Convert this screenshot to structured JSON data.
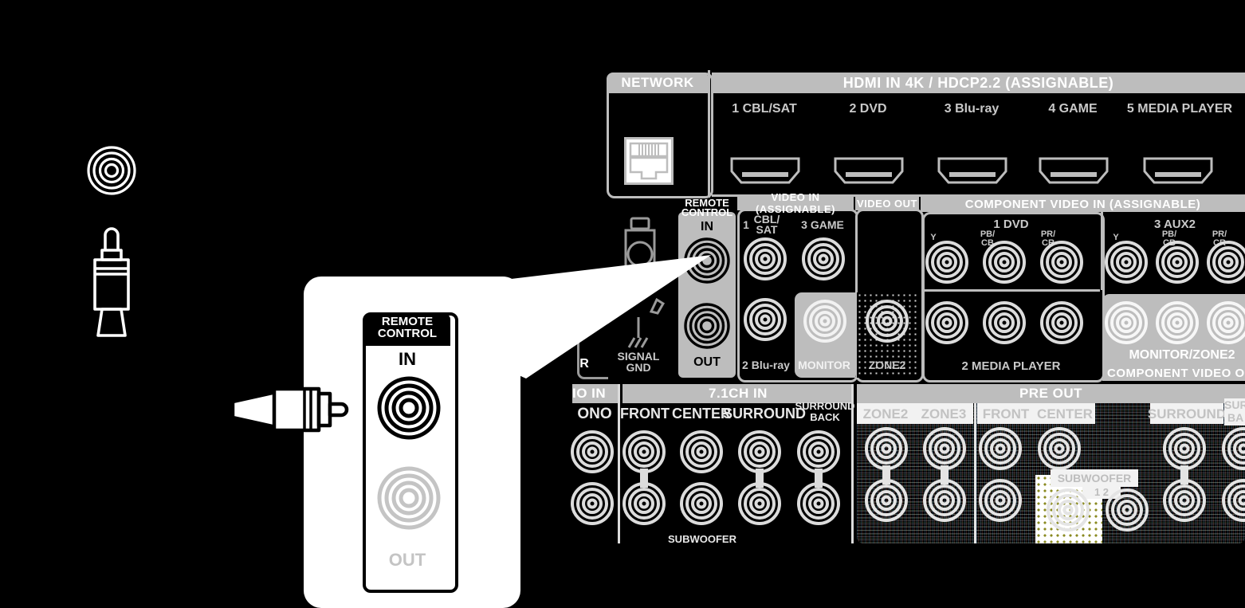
{
  "legend": {
    "jack_icon": "rca-jack-icon",
    "plug_icon": "rca-plug-icon"
  },
  "callout": {
    "cap_line1": "REMOTE",
    "cap_line2": "CONTROL",
    "in_label": "IN",
    "out_label": "OUT",
    "plug_icon": "rca-plug-horizontal-icon",
    "in_jack": "remote-control-in-jack",
    "out_jack": "remote-control-out-jack"
  },
  "rear_panel": {
    "network": {
      "header": "NETWORK",
      "port_icon": "rj45-ethernet-port-icon"
    },
    "hdmi": {
      "header": "HDMI IN   4K / HDCP2.2   (ASSIGNABLE)",
      "ports": [
        {
          "label": "1 CBL/SAT"
        },
        {
          "label": "2 DVD"
        },
        {
          "label": "3 Blu-ray"
        },
        {
          "label": "4 GAME"
        },
        {
          "label": "5 MEDIA PLAYER"
        }
      ]
    },
    "remote_control": {
      "cap_line1": "REMOTE",
      "cap_line2": "CONTROL",
      "in_label": "IN",
      "out_label": "OUT"
    },
    "antenna": {
      "icon": "am-loop-antenna-icon",
      "gnd_icon": "signal-ground-icon",
      "gnd_line1": "SIGNAL",
      "gnd_line2": "GND"
    },
    "video_in": {
      "header": "VIDEO IN (ASSIGNABLE)",
      "labels": [
        "1 CBL/\nSAT",
        "3 GAME",
        "2 Blu-ray"
      ],
      "l1a": "1",
      "l1b": "CBL/",
      "l1c": "SAT",
      "l3": "3  GAME",
      "l2": "2  Blu-ray"
    },
    "video_out": {
      "header": "VIDEO OUT",
      "monitor": "MONITOR",
      "zone2": "ZONE2"
    },
    "component_video_in": {
      "header": "COMPONENT VIDEO IN (ASSIGNABLE)",
      "group1": "1   DVD",
      "group2": "2   MEDIA PLAYER",
      "group3": "3   AUX2",
      "pins": [
        "Y",
        "PB/\nCB",
        "PR/\nCR"
      ],
      "y": "Y",
      "pb1": "PB/",
      "pb2": "CB",
      "pr1": "PR/",
      "pr2": "CR"
    },
    "component_video_out": {
      "header": "COMPONENT VIDEO O",
      "monitor_zone2": "MONITOR/ZONE2"
    },
    "audio_in": {
      "header": "IO IN",
      "phono": "ONO"
    },
    "ch71_in": {
      "header": "7.1CH IN",
      "labels": [
        "FRONT",
        "CENTER",
        "SURROUND",
        "SURROUND\nBACK"
      ],
      "front": "FRONT",
      "center": "CENTER",
      "surround": "SURROUND",
      "sb1": "SURROUND",
      "sb2": "BACK",
      "subwoofer": "SUBWOOFER"
    },
    "pre_out": {
      "header": "PRE OUT",
      "zone2": "ZONE2",
      "zone3": "ZONE3",
      "front": "FRONT",
      "center": "CENTER",
      "surround": "SURROUND",
      "sb1": "SURR",
      "sb2": "BA",
      "subwoofer": "SUBWOOFER",
      "sub_num": "1 2"
    },
    "left_edge": {
      "r_label": "R"
    }
  },
  "colors": {
    "background": "#000000",
    "panel_grey": "#bdbdbd",
    "label_grey": "#c9c9c9",
    "white": "#ffffff"
  }
}
